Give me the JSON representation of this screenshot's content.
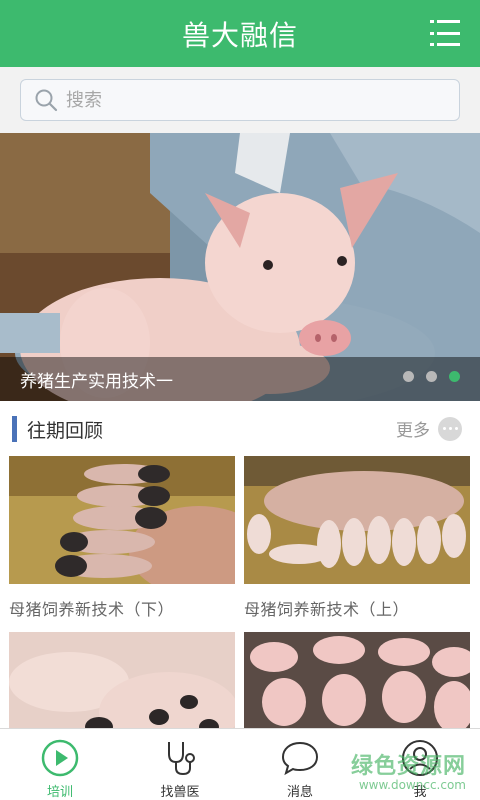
{
  "header": {
    "title": "兽大融信",
    "menu_icon": "menu-list-icon"
  },
  "search": {
    "placeholder": "搜索",
    "icon": "search-icon"
  },
  "banner": {
    "caption": "养猪生产实用技术一",
    "slide_count": 3,
    "active_slide": 3,
    "active_dot_color": "#3dba6e"
  },
  "section": {
    "title": "往期回顾",
    "more_label": "更多"
  },
  "cards": [
    {
      "title": "母猪饲养新技术（下）"
    },
    {
      "title": "母猪饲养新技术（上）"
    },
    {
      "title": ""
    },
    {
      "title": ""
    }
  ],
  "tabbar": {
    "items": [
      {
        "label": "培训",
        "icon": "play-circle-icon",
        "active": true
      },
      {
        "label": "找兽医",
        "icon": "stethoscope-icon",
        "active": false
      },
      {
        "label": "消息",
        "icon": "chat-bubble-icon",
        "active": false
      },
      {
        "label": "我",
        "icon": "person-icon",
        "active": false
      }
    ]
  },
  "watermark": {
    "main": "绿色资源网",
    "sub": "www.downcc.com"
  },
  "colors": {
    "brand": "#3dba6e",
    "section_bar": "#4a72b8"
  }
}
